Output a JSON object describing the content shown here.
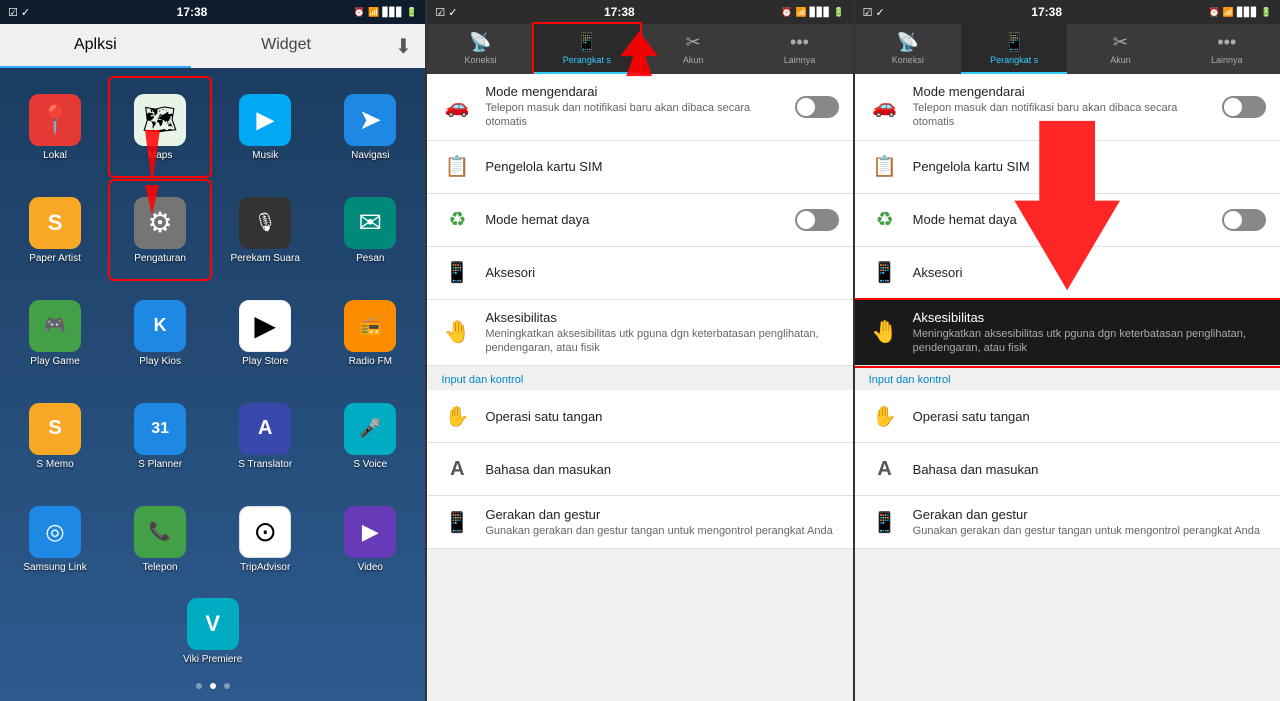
{
  "panels": {
    "p1": {
      "status": {
        "time": "17:38",
        "left_icons": "☑ ✓",
        "right_icons": "⏰ ☆ ✦ ▲▲▲ 📶 🔋"
      },
      "tabs": [
        {
          "label": "Aplksi",
          "active": true
        },
        {
          "label": "Widget",
          "active": false
        }
      ],
      "download_icon": "⬇",
      "apps": [
        {
          "label": "Lokal",
          "icon": "📍",
          "bg": "bg-red"
        },
        {
          "label": "Maps",
          "icon": "🗺",
          "bg": "bg-white",
          "highlight_outline": true
        },
        {
          "label": "Musik",
          "icon": "▶",
          "bg": "bg-light-blue"
        },
        {
          "label": "Navigasi",
          "icon": "➤",
          "bg": "bg-blue"
        },
        {
          "label": "Paper Artist",
          "icon": "S",
          "bg": "bg-yellow"
        },
        {
          "label": "Pengaturan",
          "icon": "⚙",
          "bg": "bg-gray",
          "highlighted": true
        },
        {
          "label": "Perekam Suara",
          "icon": "🎙",
          "bg": "bg-dark"
        },
        {
          "label": "Pesan",
          "icon": "✉",
          "bg": "bg-teal"
        },
        {
          "label": "Play Game",
          "icon": "🎮",
          "bg": "bg-green"
        },
        {
          "label": "Play Kios",
          "icon": "K",
          "bg": "bg-blue"
        },
        {
          "label": "Play Store",
          "icon": "▶",
          "bg": "bg-white"
        },
        {
          "label": "Radio FM",
          "icon": "📻",
          "bg": "bg-orange"
        },
        {
          "label": "S Memo",
          "icon": "S",
          "bg": "bg-yellow"
        },
        {
          "label": "S Planner",
          "icon": "31",
          "bg": "bg-blue"
        },
        {
          "label": "S Translator",
          "icon": "A",
          "bg": "bg-indigo"
        },
        {
          "label": "S Voice",
          "icon": "🎤",
          "bg": "bg-cyan"
        },
        {
          "label": "Samsung Link",
          "icon": "◎",
          "bg": "bg-blue"
        },
        {
          "label": "Telepon",
          "icon": "📞",
          "bg": "bg-green"
        },
        {
          "label": "TripAdvisor",
          "icon": "⊙",
          "bg": "bg-white"
        },
        {
          "label": "Video",
          "icon": "▶",
          "bg": "bg-deep-purple"
        },
        {
          "label": "Viki Premiere",
          "icon": "V",
          "bg": "bg-cyan"
        }
      ],
      "dots": [
        false,
        true,
        false
      ]
    },
    "p2": {
      "status": {
        "time": "17:38"
      },
      "tabs": [
        {
          "label": "Koneksi",
          "icon": "📡"
        },
        {
          "label": "Perangkat s",
          "icon": "📱",
          "active": true
        },
        {
          "label": "Akun",
          "icon": "✂"
        },
        {
          "label": "Lainnya",
          "icon": "•••"
        }
      ],
      "items": [
        {
          "title": "Mode mengendarai",
          "desc": "Telepon masuk dan notifikasi baru akan dibaca secara otomatis",
          "icon": "🔵",
          "has_toggle": true,
          "section": null
        },
        {
          "title": "Pengelola kartu SIM",
          "desc": "",
          "icon": "📋",
          "has_toggle": false,
          "section": null
        },
        {
          "title": "Mode hemat daya",
          "desc": "",
          "icon": "♻",
          "has_toggle": true,
          "section": null
        },
        {
          "title": "Aksesori",
          "desc": "",
          "icon": "📱",
          "has_toggle": false,
          "section": null
        },
        {
          "title": "Aksesibilitas",
          "desc": "Meningkatkan aksesibilitas utk pguna dgn keterbatasan penglihatan, pendengaran, atau fisik",
          "icon": "🤚",
          "has_toggle": false,
          "section": null
        },
        {
          "title": "Input dan kontrol",
          "section_header": true
        },
        {
          "title": "Operasi satu tangan",
          "desc": "",
          "icon": "✋",
          "has_toggle": false
        },
        {
          "title": "Bahasa dan masukan",
          "desc": "",
          "icon": "A",
          "has_toggle": false
        },
        {
          "title": "Gerakan dan gestur",
          "desc": "Gunakan gerakan dan gestur tangan untuk mengontrol perangkat Anda",
          "icon": "📱",
          "has_toggle": false
        }
      ]
    },
    "p3": {
      "status": {
        "time": "17:38"
      },
      "tabs": [
        {
          "label": "Koneksi",
          "icon": "📡"
        },
        {
          "label": "Perangkat s",
          "icon": "📱",
          "active": true
        },
        {
          "label": "Akun",
          "icon": "✂"
        },
        {
          "label": "Lainnya",
          "icon": "•••"
        }
      ],
      "items": [
        {
          "title": "Mode mengendarai",
          "desc": "Telepon masuk dan notifikasi baru akan dibaca secara otomatis",
          "icon": "🔵",
          "has_toggle": true
        },
        {
          "title": "Pengelola kartu SIM",
          "desc": "",
          "icon": "📋",
          "has_toggle": false
        },
        {
          "title": "Mode hemat daya",
          "desc": "",
          "icon": "♻",
          "has_toggle": true
        },
        {
          "title": "Aksesori",
          "desc": "",
          "icon": "📱",
          "has_toggle": false
        },
        {
          "title": "Aksesibilitas",
          "desc": "Meningkatkan aksesibilitas utk pguna dgn keterbatasan penglihatan, pendengaran, atau fisik",
          "icon": "🤚",
          "has_toggle": false,
          "highlighted": true
        },
        {
          "title": "Input dan kontrol",
          "section_header": true
        },
        {
          "title": "Operasi satu tangan",
          "desc": "",
          "icon": "✋",
          "has_toggle": false
        },
        {
          "title": "Bahasa dan masukan",
          "desc": "",
          "icon": "A",
          "has_toggle": false
        },
        {
          "title": "Gerakan dan gestur",
          "desc": "Gunakan gerakan dan gestur tangan untuk mengontrol perangkat Anda",
          "icon": "📱",
          "has_toggle": false
        }
      ]
    }
  }
}
